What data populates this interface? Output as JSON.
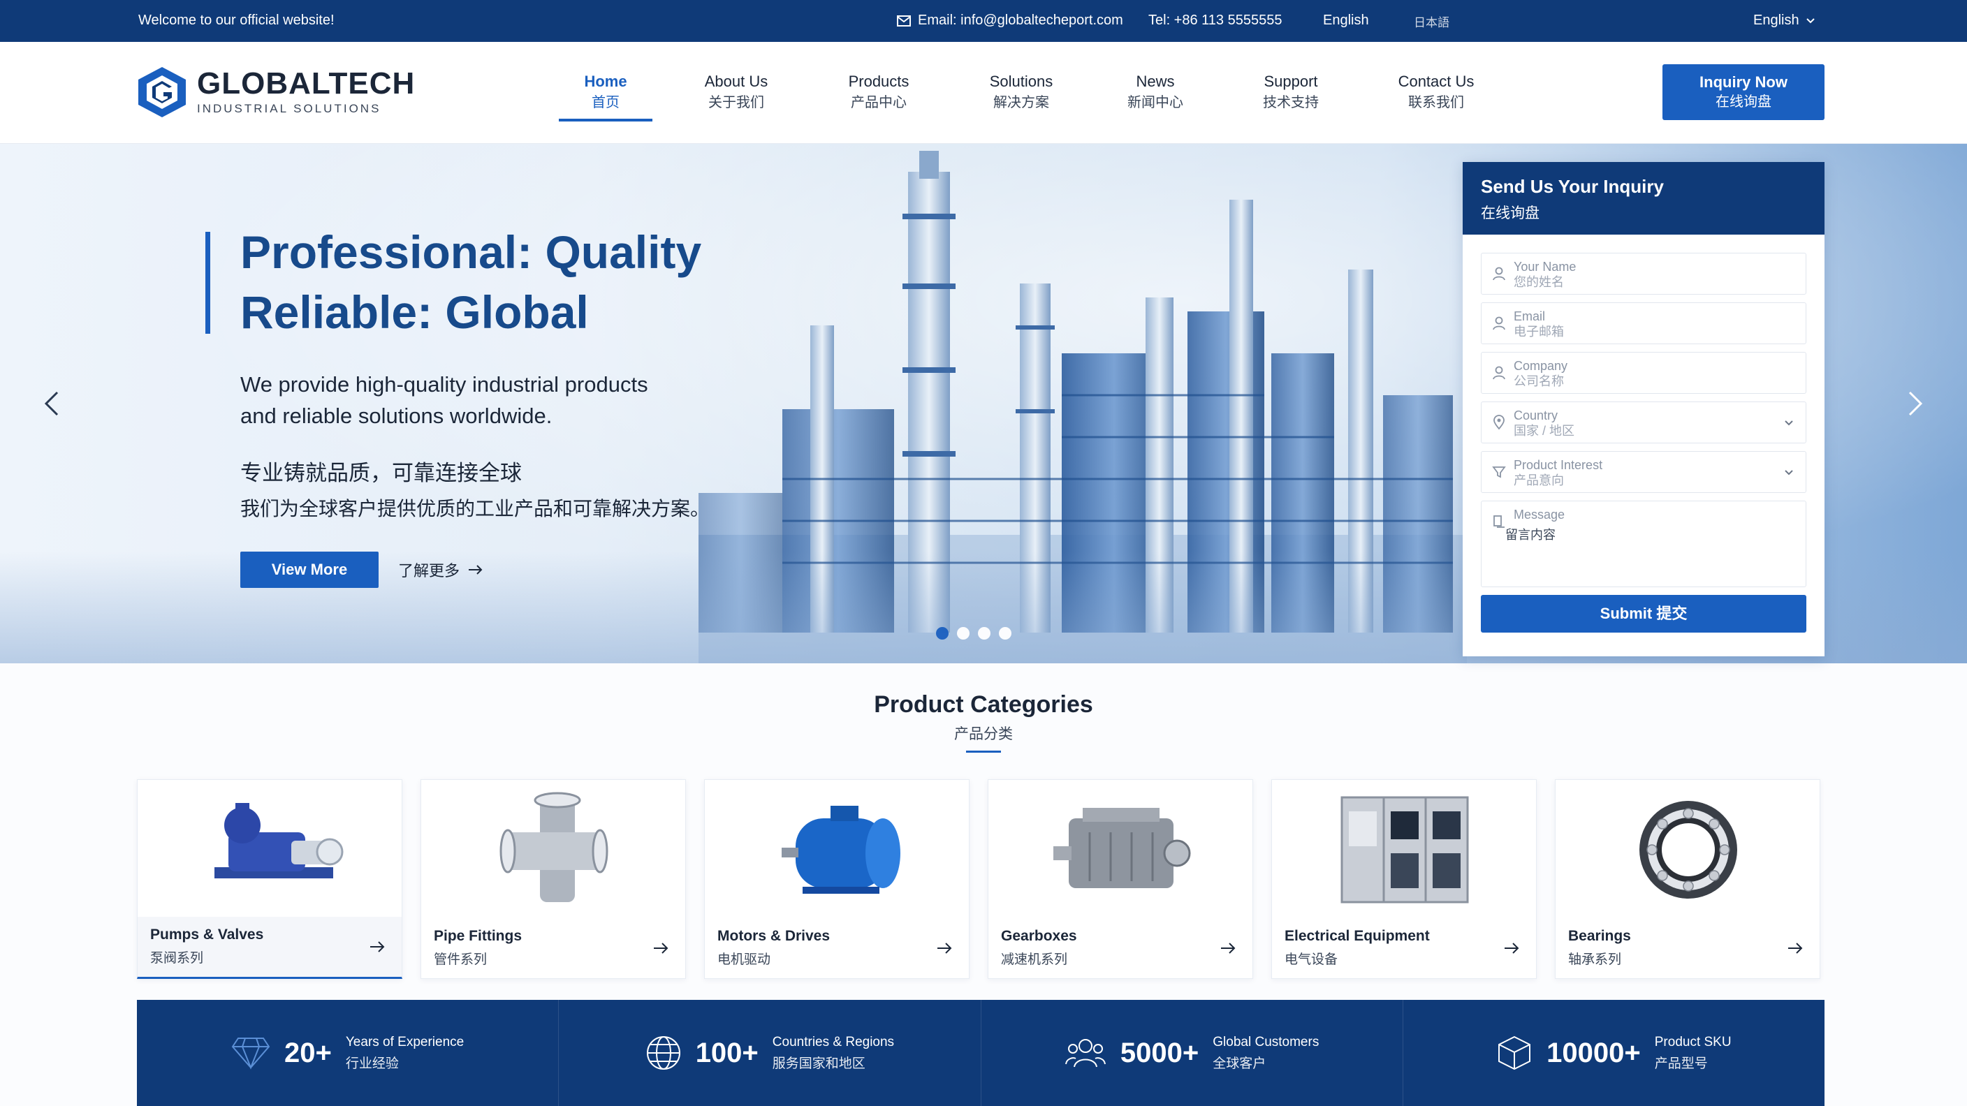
{
  "topbar": {
    "welcome": "Welcome to our official website!",
    "email": "Email: info@globaltecheport.com",
    "tel": "Tel: +86 113 5555555",
    "lang_mid": "English",
    "lang_mid2": "日本語",
    "lang_right": "English"
  },
  "logo": {
    "name": "GLOBALTECH",
    "sub": "INDUSTRIAL SOLUTIONS"
  },
  "nav": {
    "items": [
      {
        "en": "Home",
        "cn": "首页"
      },
      {
        "en": "About Us",
        "cn": "关于我们"
      },
      {
        "en": "Products",
        "cn": "产品中心"
      },
      {
        "en": "Solutions",
        "cn": "解决方案"
      },
      {
        "en": "News",
        "cn": "新闻中心"
      },
      {
        "en": "Support",
        "cn": "技术支持"
      },
      {
        "en": "Contact Us",
        "cn": "联系我们"
      }
    ]
  },
  "inquiry_button": {
    "en": "Inquiry Now",
    "cn": "在线询盘"
  },
  "hero": {
    "title_line1": "Professional: Quality",
    "title_line2": "Reliable: Global",
    "desc_line1": "We provide high-quality industrial products",
    "desc_line2": "and reliable solutions worldwide.",
    "cn_line1": "专业铸就品质，可靠连接全球",
    "cn_line2": "我们为全球客户提供优质的工业产品和可靠解决方案。",
    "view_more": "View More",
    "learn_more": "了解更多",
    "slides_total": 4,
    "active_slide": 1
  },
  "form": {
    "title": "Send Us Your Inquiry",
    "title_cn": "在线询盘",
    "fields": [
      {
        "label": "Your Name",
        "placeholder": "您的姓名",
        "icon": "user-icon"
      },
      {
        "label": "Email",
        "placeholder": "电子邮箱",
        "icon": "email-icon"
      },
      {
        "label": "Company",
        "placeholder": "公司名称",
        "icon": "company-icon"
      },
      {
        "label": "Country",
        "placeholder": "国家 / 地区",
        "icon": "location-icon"
      },
      {
        "label": "Product Interest",
        "placeholder": "产品意向",
        "icon": "filter-icon"
      }
    ],
    "message": {
      "label": "Message",
      "value": "留言内容"
    },
    "submit": "Submit  提交"
  },
  "categories": {
    "title": "Product Categories",
    "title_cn": "产品分类",
    "items": [
      {
        "name": "Pumps & Valves",
        "cn": "泵阀系列"
      },
      {
        "name": "Pipe Fittings",
        "cn": "管件系列"
      },
      {
        "name": "Motors & Drives",
        "cn": "电机驱动"
      },
      {
        "name": "Gearboxes",
        "cn": "减速机系列"
      },
      {
        "name": "Electrical Equipment",
        "cn": "电气设备"
      },
      {
        "name": "Bearings",
        "cn": "轴承系列"
      }
    ]
  },
  "stats": [
    {
      "value": "20+",
      "label": "Years of Experience",
      "cn": "行业经验",
      "icon": "diamond-icon"
    },
    {
      "value": "100+",
      "label": "Countries & Regions",
      "cn": "服务国家和地区",
      "icon": "globe-icon"
    },
    {
      "value": "5000+",
      "label": "Global Customers",
      "cn": "全球客户",
      "icon": "users-icon"
    },
    {
      "value": "10000+",
      "label": "Product SKU",
      "cn": "产品型号",
      "icon": "box-icon"
    }
  ],
  "colors": {
    "primary": "#1a5fbf",
    "navy": "#0f3a78"
  }
}
